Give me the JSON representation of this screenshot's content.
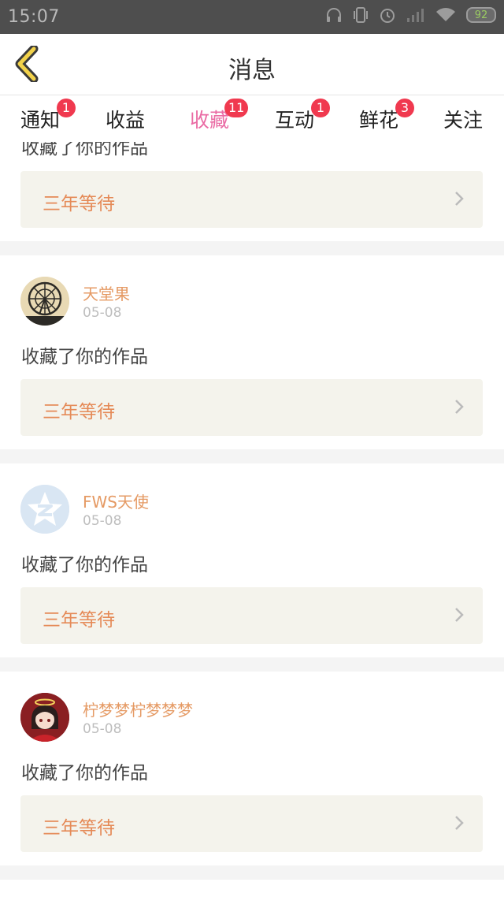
{
  "status_bar": {
    "time": "15:07",
    "battery": "92"
  },
  "header": {
    "title": "消息"
  },
  "tabs": [
    {
      "label": "通知",
      "badge": "1"
    },
    {
      "label": "收益",
      "badge": ""
    },
    {
      "label": "收藏",
      "badge": "11",
      "active": true
    },
    {
      "label": "互动",
      "badge": "1"
    },
    {
      "label": "鲜花",
      "badge": "3"
    },
    {
      "label": "关注",
      "badge": ""
    }
  ],
  "cards": [
    {
      "action": "收藏了你的作品",
      "work_title": "三年等待"
    },
    {
      "user": "天堂果",
      "date": "05-08",
      "action": "收藏了你的作品",
      "work_title": "三年等待",
      "avatar": "ferris-wheel"
    },
    {
      "user": "FWS天使",
      "date": "05-08",
      "action": "收藏了你的作品",
      "work_title": "三年等待",
      "avatar": "qzone-default"
    },
    {
      "user": "柠梦梦柠梦梦梦",
      "date": "05-08",
      "action": "收藏了你的作品",
      "work_title": "三年等待",
      "avatar": "anime-girl"
    }
  ],
  "colors": {
    "accent": "#ea6ba4",
    "badge": "#f0394f",
    "username": "#e59a64",
    "work_title": "#e58a57",
    "back_icon": "#f2d24a"
  }
}
